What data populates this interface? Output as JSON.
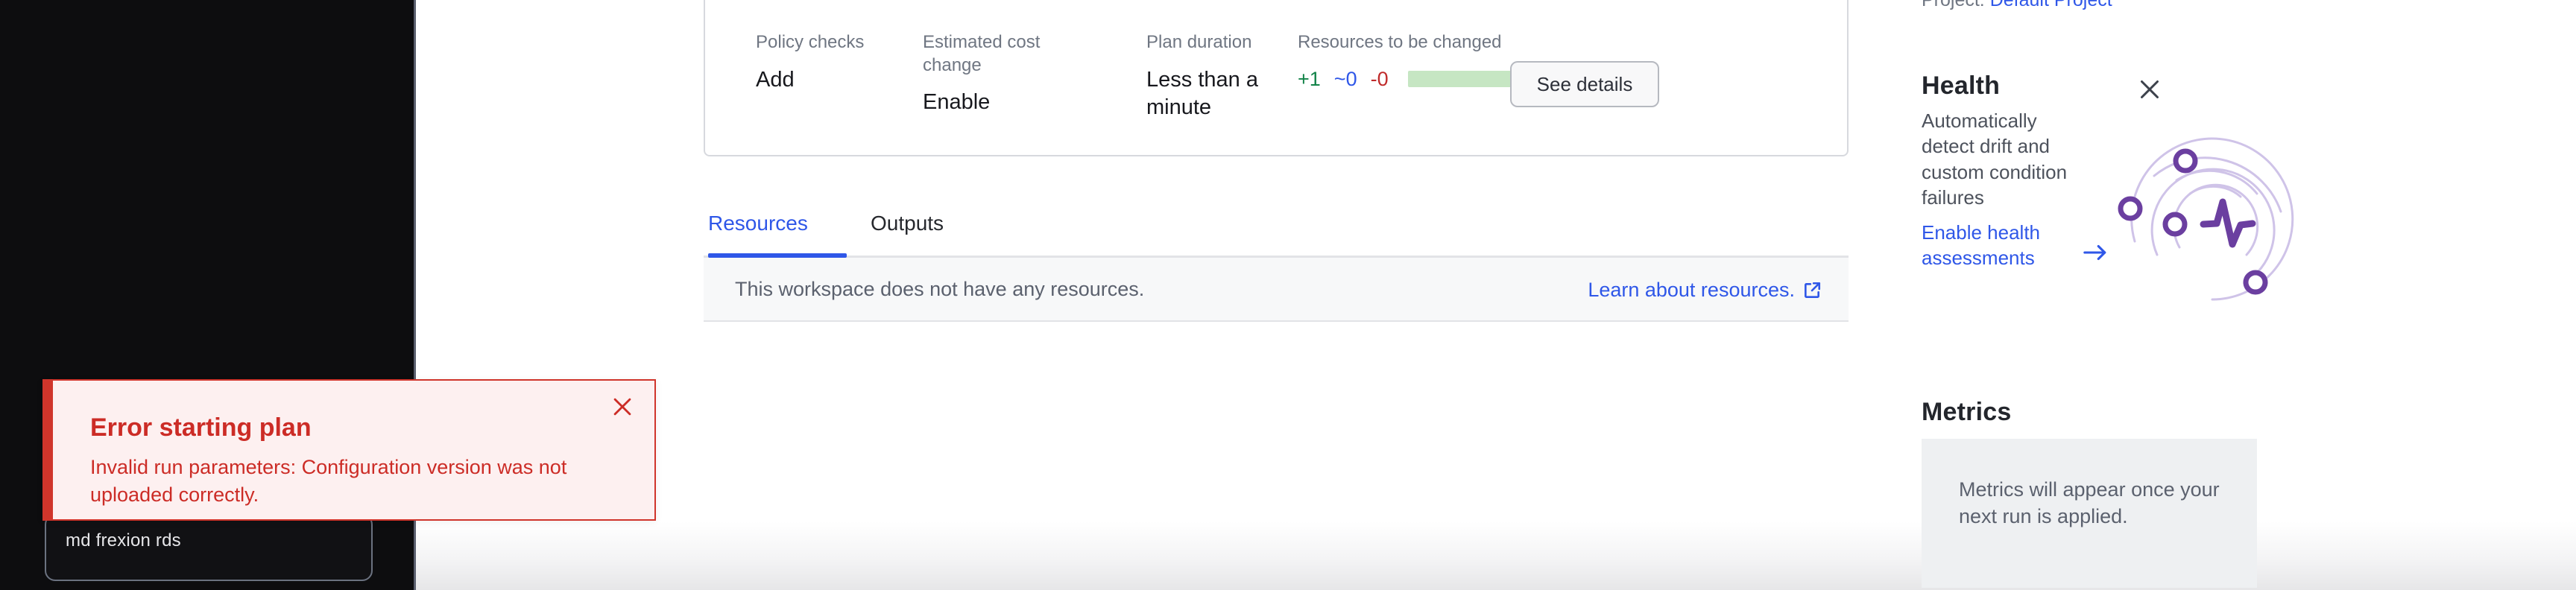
{
  "project_breadcrumb": {
    "label": "Project:",
    "value": "Default Project"
  },
  "summary": {
    "columns": [
      {
        "label": "Policy checks",
        "value": "Add"
      },
      {
        "label": "Estimated cost change",
        "value": "Enable"
      },
      {
        "label": "Plan duration",
        "value": "Less than a minute"
      },
      {
        "label": "Resources to be changed",
        "value": ""
      }
    ],
    "resources": {
      "added": "+1",
      "changed": "~0",
      "destroyed": "-0",
      "bar_color": "#c6e6c3",
      "added_color": "#128348",
      "changed_color": "#2f57e8",
      "destroyed_color": "#c02b2b"
    },
    "see_details_label": "See details"
  },
  "tabs": [
    {
      "label": "Resources",
      "active": true
    },
    {
      "label": "Outputs",
      "active": false
    }
  ],
  "resources_panel": {
    "empty_text": "This workspace does not have any resources.",
    "link_text": "Learn about resources.",
    "link_icon": "external-link-icon"
  },
  "sidebar": {
    "health": {
      "title": "Health",
      "description": "Automatically detect drift and custom condition failures",
      "cta": "Enable health assessments",
      "cta_icon": "arrow-right-icon",
      "close_icon": "close-icon",
      "illustration": "health-orbit-pulse-illustration",
      "accent_color": "#6b3fa0"
    },
    "metrics": {
      "title": "Metrics",
      "empty_text": "Metrics will appear once your next run is applied."
    }
  },
  "toast": {
    "title": "Error starting plan",
    "message": "Invalid run parameters: Configuration version was not uploaded correctly.",
    "close_icon": "close-icon",
    "accent_color": "#d0352b"
  },
  "overlay": {
    "input_text": "md  frexion  rds"
  }
}
